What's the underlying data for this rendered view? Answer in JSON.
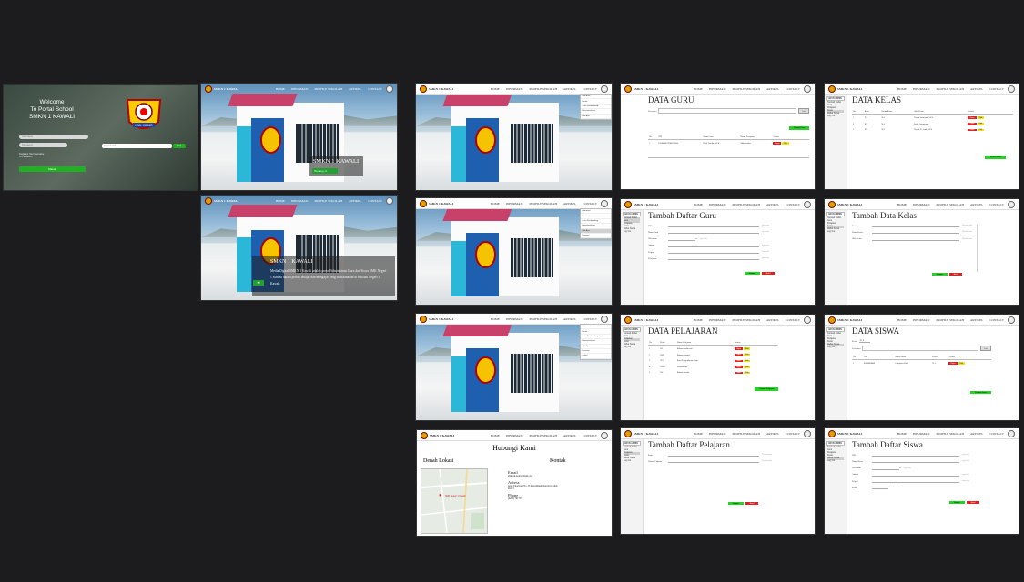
{
  "nav": {
    "brand": "SMKN 1 KAWALI",
    "menu": [
      "HOME",
      "INFORMASI",
      "PROFILE SEKOLAH",
      "ARTIKEL",
      "CONTACT"
    ]
  },
  "sidebar": {
    "header": "AKUN ADMIN",
    "items": [
      "Tambah Daftar Guru",
      "Pelajaran",
      "Kelas",
      "Daftar Siswa",
      "Log Out"
    ]
  },
  "login": {
    "welcome_line1": "Welcome",
    "welcome_line2": "To Portal  School",
    "welcome_line3": "SMKN 1 KAWALI",
    "username_placeholder": "Username",
    "password_placeholder": "Password",
    "forgot_line1": "Forgotten Your Username",
    "forgot_line2": "Or Password?",
    "login_button": "Masuk",
    "search_placeholder": "Cari sekolah...",
    "search_button": "Cari",
    "logo_caption": "KAB. CIAMIS"
  },
  "home": {
    "hero_title": "SMKN 1 KAWALI",
    "hero_button": "Tentang",
    "about_title": "SMKN 1 KAWALI",
    "about_text": "Media Digital SMKN 1 Kawali adalah portal Administrasi Guru dan Siswa SMK Negeri 1 Kawali dalam proses belajar dan mengajar yang dilaksanakan di sekolah Negeri 1 Kawali.",
    "dropdown_items": [
      "Informasi",
      "Berita",
      "Guru Pembimbing",
      "Ekstrakurikuler",
      "Alat Ajar",
      "Prestasi",
      "Galeri"
    ]
  },
  "guru": {
    "title": "DATA GURU",
    "search_placeholder": "Pencarian",
    "search_button": "Cari",
    "add_button": "Tambah Guru",
    "headers": [
      "No",
      "NIP",
      "Nama Guru",
      "Nama Pelajaran",
      "Action"
    ],
    "rows": [
      [
        "1",
        "196808061990032004",
        "Dedi Nurdin, S.Pd",
        "Matematika"
      ]
    ],
    "delete_label": "Hapus",
    "edit_label": "Edit"
  },
  "kelas": {
    "title": "DATA KELAS",
    "add_button": "Tambah Kelas",
    "headers": [
      "No",
      "Kode",
      "Nama Kelas",
      "Wali Kelas",
      "Action"
    ],
    "rows": [
      [
        "1",
        "X1",
        "X-1",
        "Yayah Sumiyati, S.Pd"
      ],
      [
        "2",
        "X2",
        "X-2",
        "Endy Gunawan"
      ],
      [
        "3",
        "X3",
        "X-3",
        "Yayah N. Amd, S.Pd"
      ]
    ]
  },
  "form_guru": {
    "title": "Tambah Daftar Guru",
    "fields": [
      "NIP",
      "Nama Guru",
      "J.Kelamin",
      "Alamat",
      "Telpon",
      "Pelajaran"
    ],
    "placeholder": "input data",
    "save_label": "Simpan",
    "cancel_label": "Batal"
  },
  "form_kelas": {
    "title": "Tambah Data Kelas",
    "fields": [
      "Kode",
      "Nama Kelas",
      "Wali Kelas"
    ],
    "placeholder": "Masukan data"
  },
  "pelajaran": {
    "title": "DATA PELAJARAN",
    "add_button": "Tambah Pelajaran",
    "headers": [
      "No",
      "Kode",
      "Nama Pelajaran",
      "Action"
    ],
    "rows": [
      [
        "1",
        "BI",
        "Bahasa Indonesia"
      ],
      [
        "2",
        "BIN",
        "Bahasa Inggris"
      ],
      [
        "3",
        "IPS",
        "Ilmu Pengetahuan Alam"
      ],
      [
        "4",
        "MTK",
        "Matematika"
      ],
      [
        "5",
        "BS",
        "Bahasa Sunda"
      ]
    ]
  },
  "siswa": {
    "title": "DATA SISWA",
    "kelas_label": "Kelas",
    "kelas_value": "X1",
    "search_placeholder": "Pencarian",
    "search_button": "Cari",
    "add_button": "Tambah Siswa",
    "headers": [
      "No",
      "NIS",
      "Nama Siswa",
      "Kelas",
      "Action"
    ],
    "rows": [
      [
        "1",
        "0098888888",
        "Cahyasari Budi",
        "X-1"
      ]
    ]
  },
  "contact": {
    "title": "Hubungi Kami",
    "map_heading": "Denah Lokasi",
    "contact_heading": "Kontak",
    "email_label": "Email",
    "email_value": "smkn1kawali@gmail.com",
    "address_label": "Adress",
    "address_value": "Jalan Talagasari No. 35 Kawalimukti Kawali Ciamis 46253",
    "phone_label": "Phone",
    "phone_value": "(0265) 791727",
    "map_pin_label": "SMK Negeri 1 Kawali"
  },
  "form_pelajaran": {
    "title": "Tambah Daftar Pelajaran",
    "fields": [
      "Kode",
      "Nama Pelajaran"
    ],
    "placeholder": "Masukan data"
  },
  "form_siswa": {
    "title": "Tambah Daftar Siswa",
    "fields": [
      "NIS",
      "Nama Siswa",
      "J.Kelamin",
      "Alamat",
      "Telpon",
      "Kelas"
    ],
    "placeholder": "input data"
  }
}
